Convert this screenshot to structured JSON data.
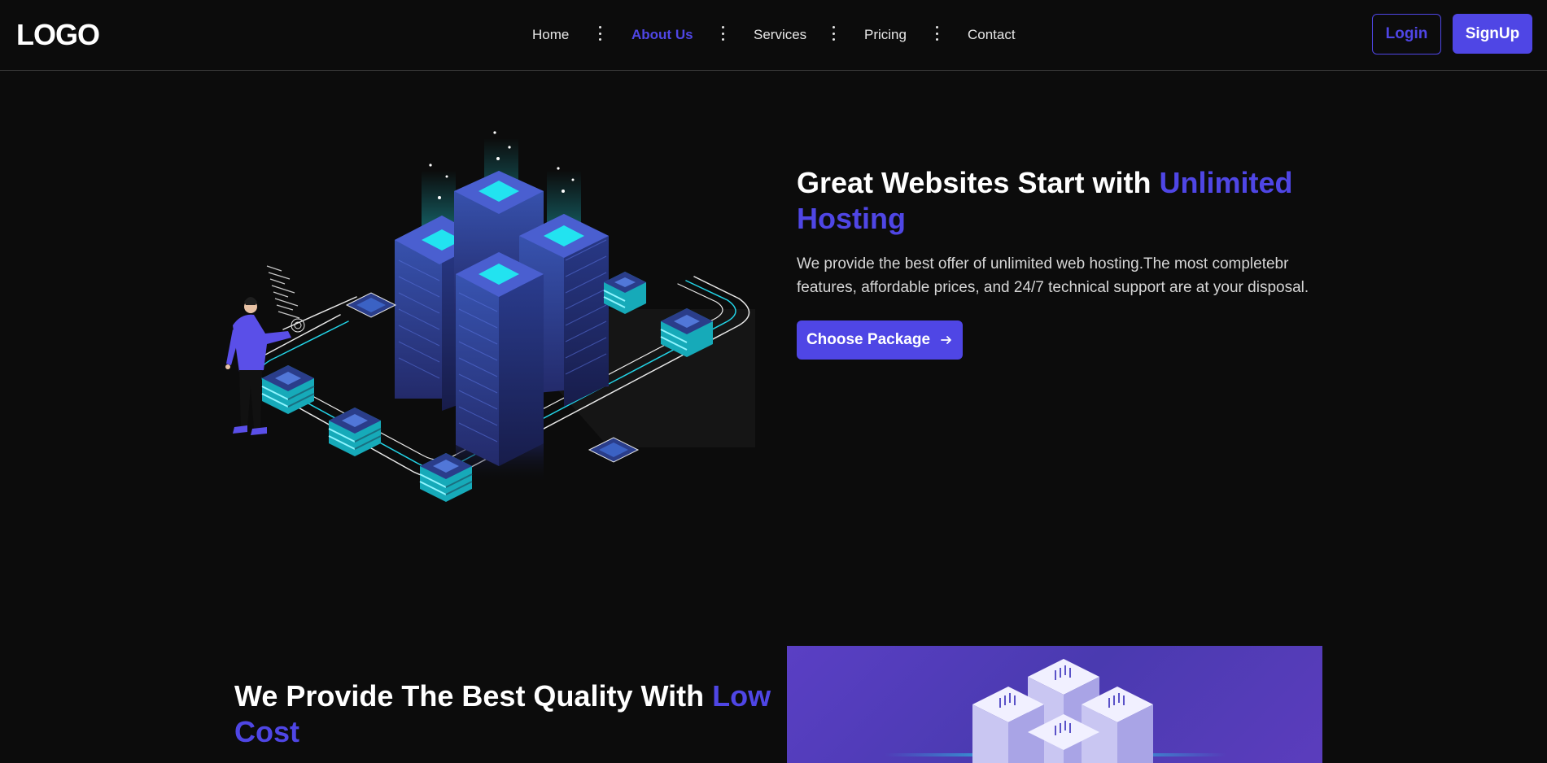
{
  "header": {
    "logo": "LOGO",
    "nav": [
      {
        "label": "Home",
        "active": false
      },
      {
        "label": "About Us",
        "active": true
      },
      {
        "label": "Services",
        "active": false
      },
      {
        "label": "Pricing",
        "active": false
      },
      {
        "label": "Contact",
        "active": false
      }
    ],
    "login_label": "Login",
    "signup_label": "SignUp"
  },
  "hero": {
    "title_plain": "Great Websites Start with ",
    "title_accent": "Unlimited Hosting",
    "description": "We provide the best offer of unlimited web hosting.The most completebr features, affordable prices, and 24/7 technical support are at your disposal.",
    "cta_label": "Choose Package",
    "cta_icon": "arrow-right-icon"
  },
  "section2": {
    "title_plain": "We Provide The Best Quality With ",
    "title_accent": "Low Cost"
  },
  "colors": {
    "accent": "#4f46e5",
    "background": "#0c0c0c",
    "text": "#ffffff",
    "muted_text": "#d6d6d6",
    "cyan_glow": "#22e3f0"
  }
}
